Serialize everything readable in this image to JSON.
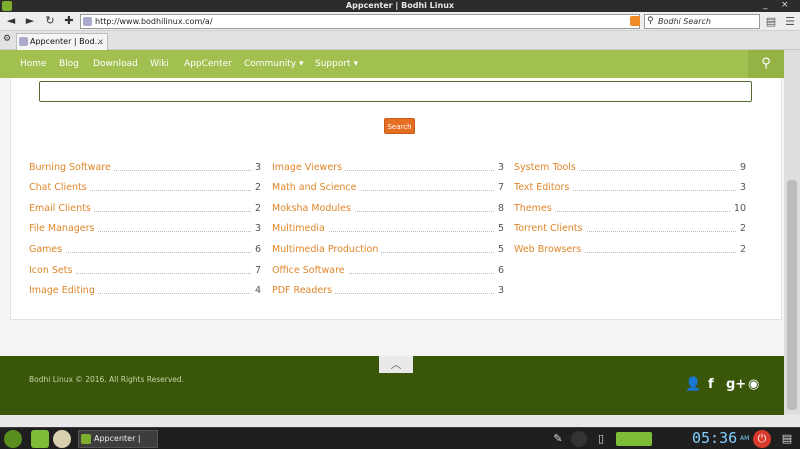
{
  "window": {
    "title": "Appcenter | Bodhi Linux",
    "min": "_",
    "close": "×"
  },
  "navbar": {
    "back": "◄",
    "forward": "►",
    "reload": "↻",
    "url": "http://www.bodhilinux.com/a/",
    "search_placeholder": "Bodhi Search"
  },
  "tabstrip": {
    "tab_label": "Appcenter | Bod...",
    "tab_close": "×"
  },
  "sitenav": {
    "items": [
      "Home",
      "Blog",
      "Download",
      "Wiki",
      "AppCenter",
      "Community ▾",
      "Support ▾"
    ]
  },
  "content": {
    "search_button": "Search",
    "col1": [
      {
        "name": "Burning Software",
        "count": "3"
      },
      {
        "name": "Chat Clients",
        "count": "2"
      },
      {
        "name": "Email Clients",
        "count": "2"
      },
      {
        "name": "File Managers",
        "count": "3"
      },
      {
        "name": "Games",
        "count": "6"
      },
      {
        "name": "Icon Sets",
        "count": "7"
      },
      {
        "name": "Image Editing",
        "count": "4"
      }
    ],
    "col2": [
      {
        "name": "Image Viewers",
        "count": "3"
      },
      {
        "name": "Math and Science",
        "count": "7"
      },
      {
        "name": "Moksha Modules",
        "count": "8"
      },
      {
        "name": "Multimedia",
        "count": "5"
      },
      {
        "name": "Multimedia Production",
        "count": "5"
      },
      {
        "name": "Office Software",
        "count": "6"
      },
      {
        "name": "PDF Readers",
        "count": "3"
      }
    ],
    "col3": [
      {
        "name": "System Tools",
        "count": "9"
      },
      {
        "name": "Text Editors",
        "count": "3"
      },
      {
        "name": "Themes",
        "count": "10"
      },
      {
        "name": "Torrent Clients",
        "count": "2"
      },
      {
        "name": "Web Browsers",
        "count": "2"
      }
    ]
  },
  "footer": {
    "copyright": "Bodhi Linux © 2016. All Rights Reserved.",
    "to_top": "︿"
  },
  "taskbar": {
    "task_label": "Appcenter | Bod...",
    "clock": "05:36",
    "ampm": "AM"
  },
  "colors": {
    "nav_green": "#a1c04f",
    "footer_green": "#3a5609",
    "link_orange": "#e0862a",
    "button_orange": "#e46f22"
  }
}
